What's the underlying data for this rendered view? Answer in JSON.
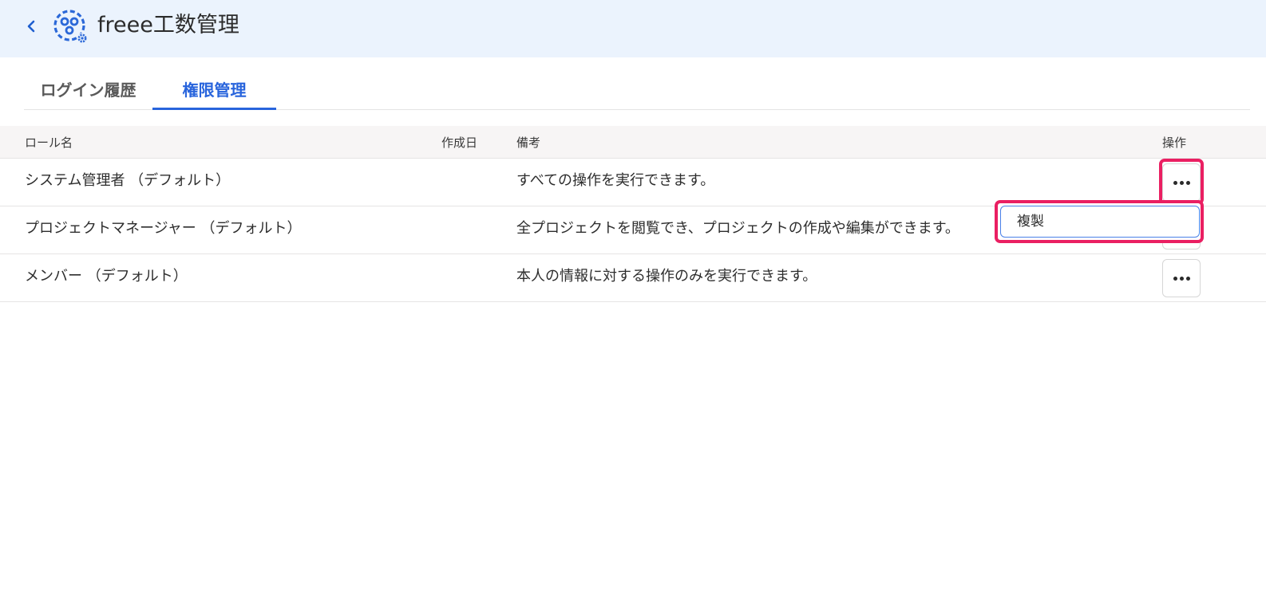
{
  "header": {
    "title": "freee工数管理"
  },
  "tabs": [
    {
      "label": "ログイン履歴",
      "active": false
    },
    {
      "label": "権限管理",
      "active": true
    }
  ],
  "table": {
    "columns": {
      "role": "ロール名",
      "created": "作成日",
      "note": "備考",
      "ops": "操作"
    },
    "rows": [
      {
        "role": "システム管理者 （デフォルト）",
        "created": "",
        "note": "すべての操作を実行できます。"
      },
      {
        "role": "プロジェクトマネージャー （デフォルト）",
        "created": "",
        "note": "全プロジェクトを閲覧でき、プロジェクトの作成や編集ができます。"
      },
      {
        "role": "メンバー （デフォルト）",
        "created": "",
        "note": "本人の情報に対する操作のみを実行できます。"
      }
    ]
  },
  "menu": {
    "items": [
      {
        "label": "複製"
      }
    ]
  },
  "colors": {
    "header_bg": "#ebf3fd",
    "accent": "#2864dc",
    "highlight": "#ea1f62"
  },
  "icons": {
    "back": "chevron-left-icon",
    "logo": "freee-gear-logo-icon",
    "ops": "more-horizontal-icon"
  }
}
